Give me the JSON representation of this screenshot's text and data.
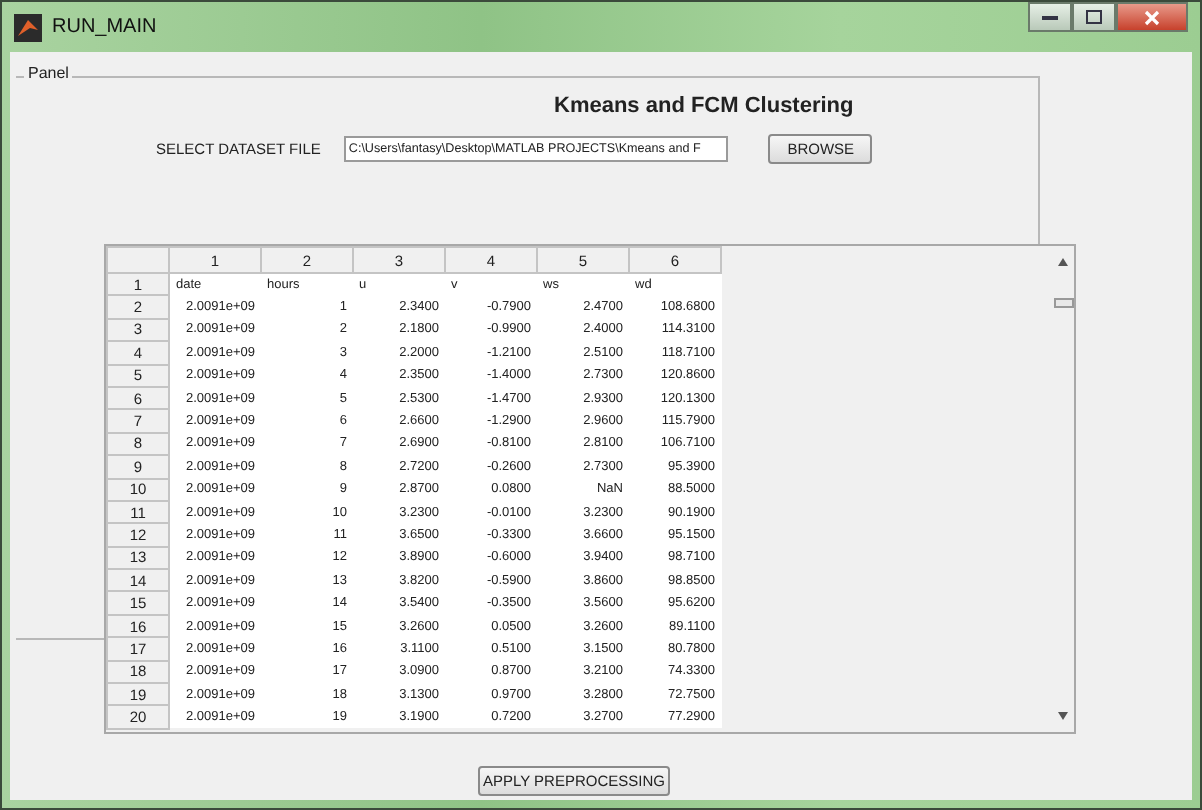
{
  "window": {
    "title": "RUN_MAIN"
  },
  "panel": {
    "legend": "Panel",
    "heading": "Kmeans and FCM Clustering",
    "file_label": "SELECT DATASET FILE",
    "file_value": "C:\\Users\\fantasy\\Desktop\\MATLAB PROJECTS\\Kmeans and F",
    "browse_button": "BROWSE"
  },
  "table": {
    "columns": [
      "1",
      "2",
      "3",
      "4",
      "5",
      "6"
    ],
    "rows": [
      {
        "header": "1",
        "kind": "text",
        "cells": [
          "date",
          "hours",
          "u",
          "v",
          "ws",
          "wd"
        ]
      },
      {
        "header": "2",
        "kind": "number",
        "cells": [
          "2.0091e+09",
          "1",
          "2.3400",
          "-0.7900",
          "2.4700",
          "108.6800"
        ]
      },
      {
        "header": "3",
        "kind": "number",
        "cells": [
          "2.0091e+09",
          "2",
          "2.1800",
          "-0.9900",
          "2.4000",
          "114.3100"
        ]
      },
      {
        "header": "4",
        "kind": "number",
        "cells": [
          "2.0091e+09",
          "3",
          "2.2000",
          "-1.2100",
          "2.5100",
          "118.7100"
        ]
      },
      {
        "header": "5",
        "kind": "number",
        "cells": [
          "2.0091e+09",
          "4",
          "2.3500",
          "-1.4000",
          "2.7300",
          "120.8600"
        ]
      },
      {
        "header": "6",
        "kind": "number",
        "cells": [
          "2.0091e+09",
          "5",
          "2.5300",
          "-1.4700",
          "2.9300",
          "120.1300"
        ]
      },
      {
        "header": "7",
        "kind": "number",
        "cells": [
          "2.0091e+09",
          "6",
          "2.6600",
          "-1.2900",
          "2.9600",
          "115.7900"
        ]
      },
      {
        "header": "8",
        "kind": "number",
        "cells": [
          "2.0091e+09",
          "7",
          "2.6900",
          "-0.8100",
          "2.8100",
          "106.7100"
        ]
      },
      {
        "header": "9",
        "kind": "number",
        "cells": [
          "2.0091e+09",
          "8",
          "2.7200",
          "-0.2600",
          "2.7300",
          "95.3900"
        ]
      },
      {
        "header": "10",
        "kind": "number",
        "cells": [
          "2.0091e+09",
          "9",
          "2.8700",
          "0.0800",
          "NaN",
          "88.5000"
        ]
      },
      {
        "header": "11",
        "kind": "number",
        "cells": [
          "2.0091e+09",
          "10",
          "3.2300",
          "-0.0100",
          "3.2300",
          "90.1900"
        ]
      },
      {
        "header": "12",
        "kind": "number",
        "cells": [
          "2.0091e+09",
          "11",
          "3.6500",
          "-0.3300",
          "3.6600",
          "95.1500"
        ]
      },
      {
        "header": "13",
        "kind": "number",
        "cells": [
          "2.0091e+09",
          "12",
          "3.8900",
          "-0.6000",
          "3.9400",
          "98.7100"
        ]
      },
      {
        "header": "14",
        "kind": "number",
        "cells": [
          "2.0091e+09",
          "13",
          "3.8200",
          "-0.5900",
          "3.8600",
          "98.8500"
        ]
      },
      {
        "header": "15",
        "kind": "number",
        "cells": [
          "2.0091e+09",
          "14",
          "3.5400",
          "-0.3500",
          "3.5600",
          "95.6200"
        ]
      },
      {
        "header": "16",
        "kind": "number",
        "cells": [
          "2.0091e+09",
          "15",
          "3.2600",
          "0.0500",
          "3.2600",
          "89.1100"
        ]
      },
      {
        "header": "17",
        "kind": "number",
        "cells": [
          "2.0091e+09",
          "16",
          "3.1100",
          "0.5100",
          "3.1500",
          "80.7800"
        ]
      },
      {
        "header": "18",
        "kind": "number",
        "cells": [
          "2.0091e+09",
          "17",
          "3.0900",
          "0.8700",
          "3.2100",
          "74.3300"
        ]
      },
      {
        "header": "19",
        "kind": "number",
        "cells": [
          "2.0091e+09",
          "18",
          "3.1300",
          "0.9700",
          "3.2800",
          "72.7500"
        ]
      },
      {
        "header": "20",
        "kind": "number",
        "cells": [
          "2.0091e+09",
          "19",
          "3.1900",
          "0.7200",
          "3.2700",
          "77.2900"
        ]
      }
    ]
  },
  "apply_button": "APPLY PREPROCESSING"
}
